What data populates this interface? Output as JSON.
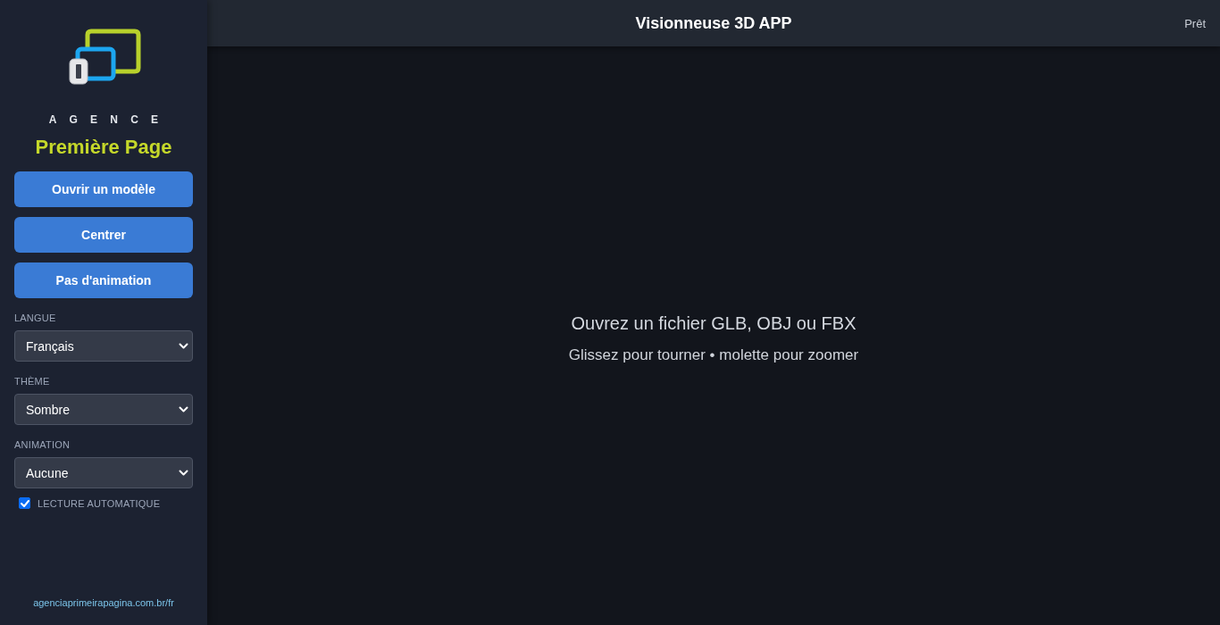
{
  "sidebar": {
    "logo": {
      "top_word": "AGENCE",
      "brand": "Première Page"
    },
    "buttons": [
      {
        "label": "Ouvrir un modèle"
      },
      {
        "label": "Centrer"
      },
      {
        "label": "Pas d'animation"
      }
    ],
    "fields": [
      {
        "label": "LANGUE",
        "value": "Français"
      },
      {
        "label": "THÈME",
        "value": "Sombre"
      },
      {
        "label": "ANIMATION",
        "value": "Aucune"
      }
    ],
    "autoplay": {
      "label": "LECTURE AUTOMATIQUE",
      "checked": true
    },
    "footer_link": "agenciaprimeirapagina.com.br/fr"
  },
  "header": {
    "title": "Visionneuse 3D APP",
    "status": "Prêt"
  },
  "viewport": {
    "heading": "Ouvrez un fichier GLB, OBJ ou FBX",
    "hint": "Glissez pour tourner • molette pour zoomer"
  }
}
